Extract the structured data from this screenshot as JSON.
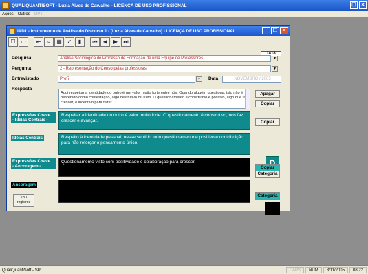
{
  "app": {
    "title": "QUALIQUANTISOFT - Luzia Alves de Carvalho - LICENÇA DE USO PROFISSIONAL",
    "menu": [
      "Ações",
      "Outros",
      "OPT"
    ]
  },
  "form": {
    "title": "IAD1 - Instrumento de Análise do Discurso 1 - [Luzia Alves de Carvalho] - LICENÇA DE USO PROFISSIONAL",
    "record_id": "1418",
    "labels": {
      "pesquisa": "Pesquisa",
      "pergunta": "Pergunta",
      "entrevistado": "Entrevistado",
      "data": "Data",
      "resposta": "Resposta",
      "ideias_centrais": "Idéias Centrais",
      "ancoragem": "Ancoragem"
    },
    "pesquisa_value": "Análise Sociológica do Processo de Formação de uma Equipe de Professores",
    "pergunta_value": "2 - Representação do Censo pelas professoras.",
    "entrevistado_value": "Prof7",
    "data_value": "NOVEMBRO / 2005",
    "resposta_text": "Aqui respeitar a identidade do outro é um valor muito forte entre nós. Quando alguém questiona, isto não é percebido como contestação, algo destrutivo ou ruim. O questionamento é construtivo e positivo, algo que faz crescer, é incentivo para fazer",
    "expressoes_chave_label_1": "Expressões Chave",
    "expressoes_chave_label_2": "- Idéias Centrais -",
    "expressoes_chave_text": "Respeitar a identidade do outro é valor muito forte. O questionamento é construtivo, nos faz crescer e avançar.",
    "ideias_centrais_text": "Respeito à identidade pessoal, nesse sentido todo questionamento é positivo e contribuição para não reforçar o pensamento único.",
    "expressoes_ancoragem_label_1": "Expressões Chave",
    "expressoes_ancoragem_label_2": "- Ancoragem -",
    "expressoes_ancoragem_text": "Questionamento visto com positividade e colaboração para crescer.",
    "ancoragem_text": "",
    "buttons": {
      "apagar": "Apagar",
      "copiar1": "Copiar",
      "copiar2": "Copiar",
      "categoria1": "Categoria",
      "copiar3": "Copiar",
      "categoria2": "Categoria"
    },
    "category_letter": "D",
    "records_count": "130",
    "records_label": "registros",
    "toolbar_icons": [
      "new-icon",
      "save-icon",
      "go-back-icon",
      "search-icon",
      "grid-icon",
      "spelling-icon",
      "delete-icon",
      "first-record-icon",
      "previous-record-icon",
      "next-record-icon",
      "last-record-icon"
    ],
    "accent_teal": "#0f8b8d"
  },
  "statusbar": {
    "left": "QualiQuantiSoft - SPI",
    "caps": "CAPS",
    "num": "NUM",
    "date": "8/11/2005",
    "time": "08:22"
  }
}
